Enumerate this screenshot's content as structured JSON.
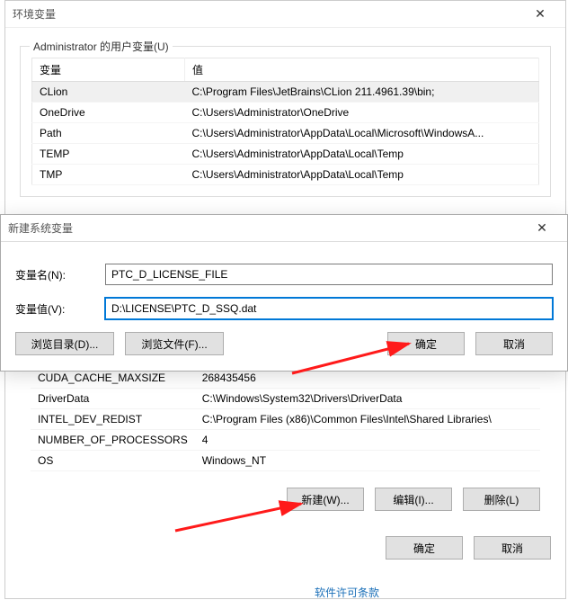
{
  "env_dialog": {
    "title": "环境变量",
    "close": "✕",
    "user_group_label": "Administrator 的用户变量(U)",
    "columns": {
      "variable": "变量",
      "value": "值"
    },
    "user_vars": [
      {
        "name": "CLion",
        "value": "C:\\Program Files\\JetBrains\\CLion 211.4961.39\\bin;",
        "selected": true
      },
      {
        "name": "OneDrive",
        "value": "C:\\Users\\Administrator\\OneDrive"
      },
      {
        "name": "Path",
        "value": "C:\\Users\\Administrator\\AppData\\Local\\Microsoft\\WindowsA..."
      },
      {
        "name": "TEMP",
        "value": "C:\\Users\\Administrator\\AppData\\Local\\Temp"
      },
      {
        "name": "TMP",
        "value": "C:\\Users\\Administrator\\AppData\\Local\\Temp"
      }
    ],
    "system_vars": [
      {
        "name": "CUDA_CACHE_MAXSIZE",
        "value": "268435456"
      },
      {
        "name": "DriverData",
        "value": "C:\\Windows\\System32\\Drivers\\DriverData"
      },
      {
        "name": "INTEL_DEV_REDIST",
        "value": "C:\\Program Files (x86)\\Common Files\\Intel\\Shared Libraries\\"
      },
      {
        "name": "NUMBER_OF_PROCESSORS",
        "value": "4"
      },
      {
        "name": "OS",
        "value": "Windows_NT"
      }
    ],
    "buttons": {
      "new": "新建(W)...",
      "edit": "编辑(I)...",
      "delete": "删除(L)",
      "ok": "确定",
      "cancel": "取消"
    }
  },
  "new_var_dialog": {
    "title": "新建系统变量",
    "close": "✕",
    "name_label": "变量名(N):",
    "value_label": "变量值(V):",
    "name_value": "PTC_D_LICENSE_FILE",
    "value_value": "D:\\LICENSE\\PTC_D_SSQ.dat",
    "browse_dir": "浏览目录(D)...",
    "browse_file": "浏览文件(F)...",
    "ok": "确定",
    "cancel": "取消"
  },
  "footer_link": "软件许可条款"
}
